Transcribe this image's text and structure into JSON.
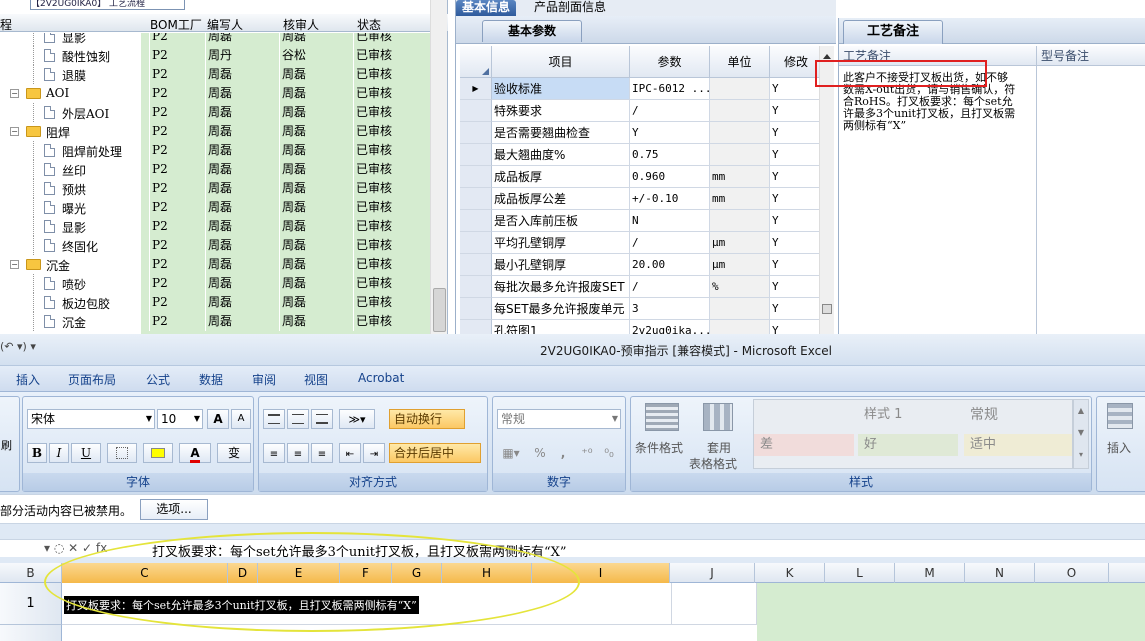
{
  "tree": {
    "top_strip_text": "【2V2UG0IKA0】 工艺流程",
    "headers": {
      "col0": "程",
      "bom": "BOM工厂",
      "writer": "编写人",
      "checker": "核审人",
      "status": "状态"
    },
    "rows": [
      {
        "indent": 2,
        "kind": "file",
        "name": "显影",
        "bom": "P2",
        "writer": "周磊",
        "checker": "周磊",
        "status": "已审核"
      },
      {
        "indent": 2,
        "kind": "file",
        "name": "酸性蚀刻",
        "bom": "P2",
        "writer": "周丹",
        "checker": "谷松",
        "status": "已审核"
      },
      {
        "indent": 2,
        "kind": "file",
        "name": "退膜",
        "bom": "P2",
        "writer": "周磊",
        "checker": "周磊",
        "status": "已审核"
      },
      {
        "indent": 1,
        "kind": "folder",
        "name": "AOI",
        "bom": "P2",
        "writer": "周磊",
        "checker": "周磊",
        "status": "已审核"
      },
      {
        "indent": 2,
        "kind": "file",
        "name": "外层AOI",
        "bom": "P2",
        "writer": "周磊",
        "checker": "周磊",
        "status": "已审核"
      },
      {
        "indent": 1,
        "kind": "folder",
        "name": "阻焊",
        "bom": "P2",
        "writer": "周磊",
        "checker": "周磊",
        "status": "已审核"
      },
      {
        "indent": 2,
        "kind": "file",
        "name": "阻焊前处理",
        "bom": "P2",
        "writer": "周磊",
        "checker": "周磊",
        "status": "已审核"
      },
      {
        "indent": 2,
        "kind": "file",
        "name": "丝印",
        "bom": "P2",
        "writer": "周磊",
        "checker": "周磊",
        "status": "已审核"
      },
      {
        "indent": 2,
        "kind": "file",
        "name": "预烘",
        "bom": "P2",
        "writer": "周磊",
        "checker": "周磊",
        "status": "已审核"
      },
      {
        "indent": 2,
        "kind": "file",
        "name": "曝光",
        "bom": "P2",
        "writer": "周磊",
        "checker": "周磊",
        "status": "已审核"
      },
      {
        "indent": 2,
        "kind": "file",
        "name": "显影",
        "bom": "P2",
        "writer": "周磊",
        "checker": "周磊",
        "status": "已审核"
      },
      {
        "indent": 2,
        "kind": "file",
        "name": "终固化",
        "bom": "P2",
        "writer": "周磊",
        "checker": "周磊",
        "status": "已审核"
      },
      {
        "indent": 1,
        "kind": "folder",
        "name": "沉金",
        "bom": "P2",
        "writer": "周磊",
        "checker": "周磊",
        "status": "已审核"
      },
      {
        "indent": 2,
        "kind": "file",
        "name": "喷砂",
        "bom": "P2",
        "writer": "周磊",
        "checker": "周磊",
        "status": "已审核"
      },
      {
        "indent": 2,
        "kind": "file",
        "name": "板边包胶",
        "bom": "P2",
        "writer": "周磊",
        "checker": "周磊",
        "status": "已审核"
      },
      {
        "indent": 2,
        "kind": "file",
        "name": "沉金",
        "bom": "P2",
        "writer": "周磊",
        "checker": "周磊",
        "status": "已审核"
      }
    ]
  },
  "params": {
    "tabs": [
      "基本信息",
      "产品剖面信息"
    ],
    "subtab": "基本参数",
    "headers": {
      "item": "项目",
      "param": "参数",
      "unit": "单位",
      "mod": "修改"
    },
    "rows": [
      {
        "item": "验收标准",
        "param": "IPC-6012 ...",
        "unit": "",
        "mod": "Y",
        "selected": true
      },
      {
        "item": "特殊要求",
        "param": "/",
        "unit": "",
        "mod": "Y"
      },
      {
        "item": "是否需要翘曲检查",
        "param": "Y",
        "unit": "",
        "mod": "Y"
      },
      {
        "item": "最大翘曲度%",
        "param": "0.75",
        "unit": "",
        "mod": "Y"
      },
      {
        "item": "成品板厚",
        "param": "0.960",
        "unit": "mm",
        "mod": "Y"
      },
      {
        "item": "成品板厚公差",
        "param": "+/-0.10",
        "unit": "mm",
        "mod": "Y"
      },
      {
        "item": "是否入库前压板",
        "param": "N",
        "unit": "",
        "mod": "Y"
      },
      {
        "item": "平均孔壁铜厚",
        "param": "/",
        "unit": "μm",
        "mod": "Y"
      },
      {
        "item": "最小孔壁铜厚",
        "param": "20.00",
        "unit": "μm",
        "mod": "Y"
      },
      {
        "item": "每批次最多允许报废SET",
        "param": "/",
        "unit": "%",
        "mod": "Y"
      },
      {
        "item": "每SET最多允许报废单元",
        "param": "3",
        "unit": "",
        "mod": "Y"
      },
      {
        "item": "孔符图1",
        "param": "2v2ug0ika...",
        "unit": "",
        "mod": "Y"
      }
    ]
  },
  "notes": {
    "tab": "工艺备注",
    "col1": "工艺备注",
    "col2": "型号备注",
    "text": "此客户不接受打叉板出货，如不够数需X-out出货，请与销售确认，符合RoHS。打叉板要求：每个set允许最多3个unit打叉板，且打叉板需两侧标有“X”"
  },
  "excel": {
    "title": "2V2UG0IKA0-预审指示 [兼容模式] - Microsoft Excel",
    "qat": "(↶ ▾) ▾",
    "menus": [
      "插入",
      "页面布局",
      "公式",
      "数据",
      "审阅",
      "视图",
      "Acrobat"
    ],
    "font_name": "宋体",
    "font_size": "10",
    "font_grow": "A",
    "font_shrink": "A",
    "bold": "B",
    "italic": "I",
    "underline": "U",
    "font_color_glyph": "A",
    "wen": "变",
    "wrap_text": "自动换行",
    "merge_center": "合并后居中",
    "number_format": "常规",
    "percent": "%",
    "comma": ",",
    "cond_format": "条件格式",
    "table_format_1": "套用",
    "table_format_2": "表格格式",
    "style_1": "样式 1",
    "style_normal": "常规",
    "style_bad": "差",
    "style_good": "好",
    "style_neutral": "适中",
    "insert": "插入",
    "brush": "刷",
    "groups": {
      "font": "字体",
      "align": "对齐方式",
      "number": "数字",
      "styles": "样式"
    },
    "msg": "部分活动内容已被禁用。",
    "options_button": "选项...",
    "formula_icons": "▾ ◌ ✕ ✓ fx",
    "formula_value": "打叉板要求：每个set允许最多3个unit打叉板，且打叉板需两侧标有“X”",
    "columns": [
      "B",
      "C",
      "D",
      "E",
      "F",
      "G",
      "H",
      "I",
      "J",
      "K",
      "L",
      "M",
      "N",
      "O"
    ],
    "row_number": "1",
    "cell_text": "打叉板要求：每个set允许最多3个unit打叉板，且打叉板需两侧标有“X”"
  }
}
